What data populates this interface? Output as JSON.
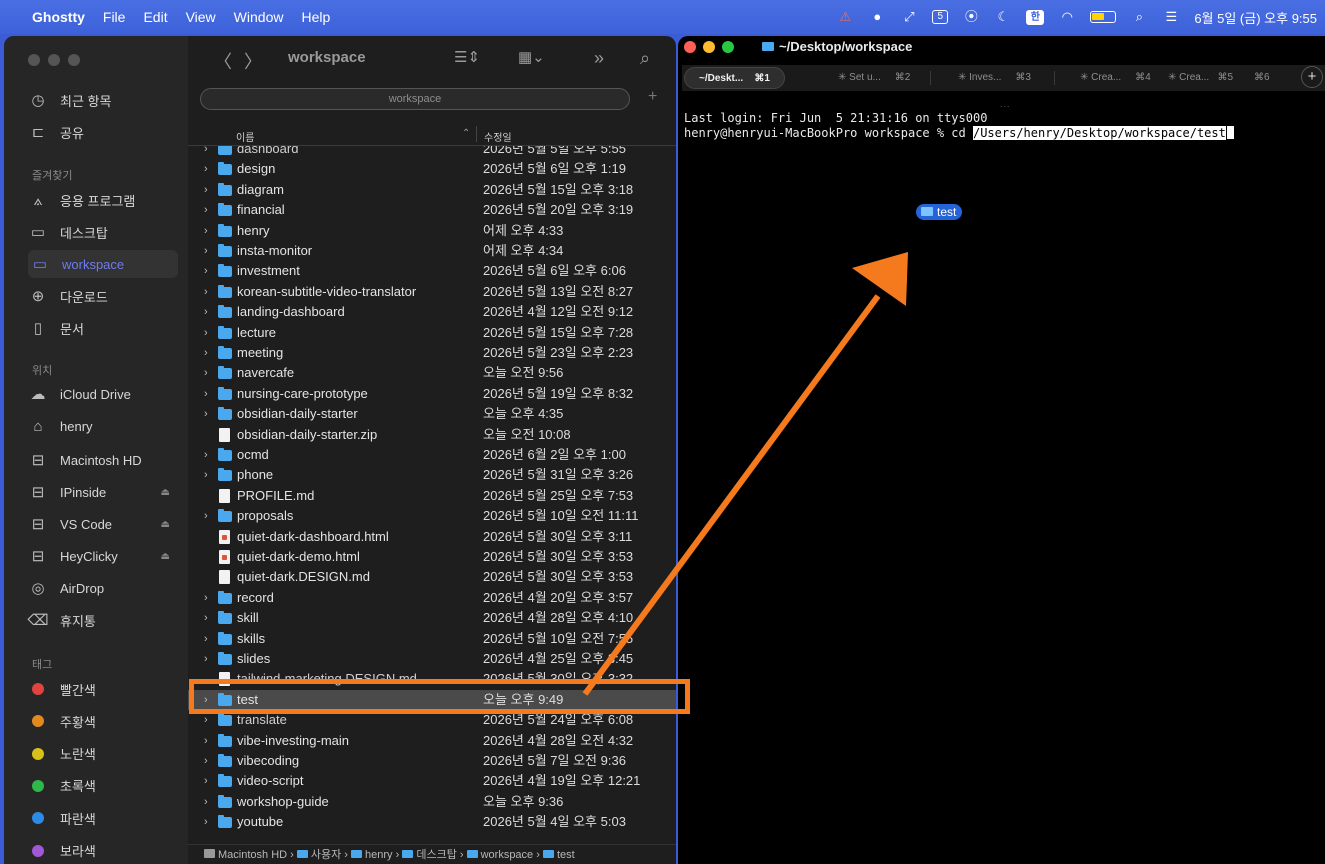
{
  "menubar": {
    "app": "Ghostty",
    "menus": [
      "File",
      "Edit",
      "View",
      "Window",
      "Help"
    ],
    "datetime": "6월 5일 (금) 오후 9:55",
    "calendar_badge": "5",
    "input_source": "한"
  },
  "finder": {
    "title": "workspace",
    "search_pill": "workspace",
    "sidebar": {
      "recents": "최근 항목",
      "shared": "공유",
      "favorites_header": "즐겨찾기",
      "favorites": [
        "응용 프로그램",
        "데스크탑",
        "workspace",
        "다운로드",
        "문서"
      ],
      "locations_header": "위치",
      "locations": [
        "iCloud Drive",
        "henry",
        "Macintosh HD",
        "IPinside",
        "VS Code",
        "HeyClicky",
        "AirDrop",
        "휴지통"
      ],
      "tags_header": "태그",
      "tags": [
        {
          "name": "빨간색",
          "color": "#e0443e"
        },
        {
          "name": "주황색",
          "color": "#e38a1e"
        },
        {
          "name": "노란색",
          "color": "#d8c21a"
        },
        {
          "name": "초록색",
          "color": "#2fb84a"
        },
        {
          "name": "파란색",
          "color": "#2d8ae6"
        },
        {
          "name": "보라색",
          "color": "#a158d6"
        }
      ]
    },
    "columns": {
      "name": "이름",
      "modified": "수정일"
    },
    "rows": [
      {
        "name": "dashboard",
        "date": "2026년 5월 5일 오후 5:55",
        "kind": "folder",
        "cut": true
      },
      {
        "name": "design",
        "date": "2026년 5월 6일 오후 1:19",
        "kind": "folder"
      },
      {
        "name": "diagram",
        "date": "2026년 5월 15일 오후 3:18",
        "kind": "folder"
      },
      {
        "name": "financial",
        "date": "2026년 5월 20일 오후 3:19",
        "kind": "folder"
      },
      {
        "name": "henry",
        "date": "어제 오후 4:33",
        "kind": "folder"
      },
      {
        "name": "insta-monitor",
        "date": "어제 오후 4:34",
        "kind": "folder"
      },
      {
        "name": "investment",
        "date": "2026년 5월 6일 오후 6:06",
        "kind": "folder"
      },
      {
        "name": "korean-subtitle-video-translator",
        "date": "2026년 5월 13일 오전 8:27",
        "kind": "folder"
      },
      {
        "name": "landing-dashboard",
        "date": "2026년 4월 12일 오전 9:12",
        "kind": "folder"
      },
      {
        "name": "lecture",
        "date": "2026년 5월 15일 오후 7:28",
        "kind": "folder"
      },
      {
        "name": "meeting",
        "date": "2026년 5월 23일 오후 2:23",
        "kind": "folder"
      },
      {
        "name": "navercafe",
        "date": "오늘 오전 9:56",
        "kind": "folder"
      },
      {
        "name": "nursing-care-prototype",
        "date": "2026년 5월 19일 오후 8:32",
        "kind": "folder"
      },
      {
        "name": "obsidian-daily-starter",
        "date": "오늘 오후 4:35",
        "kind": "folder"
      },
      {
        "name": "obsidian-daily-starter.zip",
        "date": "오늘 오전 10:08",
        "kind": "file"
      },
      {
        "name": "ocmd",
        "date": "2026년 6월 2일 오후 1:00",
        "kind": "folder"
      },
      {
        "name": "phone",
        "date": "2026년 5월 31일 오후 3:26",
        "kind": "folder"
      },
      {
        "name": "PROFILE.md",
        "date": "2026년 5월 25일 오후 7:53",
        "kind": "file"
      },
      {
        "name": "proposals",
        "date": "2026년 5월 10일 오전 11:11",
        "kind": "folder"
      },
      {
        "name": "quiet-dark-dashboard.html",
        "date": "2026년 5월 30일 오후 3:11",
        "kind": "html"
      },
      {
        "name": "quiet-dark-demo.html",
        "date": "2026년 5월 30일 오후 3:53",
        "kind": "html"
      },
      {
        "name": "quiet-dark.DESIGN.md",
        "date": "2026년 5월 30일 오후 3:53",
        "kind": "file"
      },
      {
        "name": "record",
        "date": "2026년 4월 20일 오후 3:57",
        "kind": "folder"
      },
      {
        "name": "skill",
        "date": "2026년 4월 28일 오후 4:10",
        "kind": "folder"
      },
      {
        "name": "skills",
        "date": "2026년 5월 10일 오전 7:55",
        "kind": "folder"
      },
      {
        "name": "slides",
        "date": "2026년 4월 25일 오후 3:45",
        "kind": "folder"
      },
      {
        "name": "tailwind-marketing.DESIGN.md",
        "date": "2026년 5월 30일 오후 3:32",
        "kind": "file",
        "cut": true
      },
      {
        "name": "test",
        "date": "오늘 오후 9:49",
        "kind": "folder",
        "selected": true
      },
      {
        "name": "translate",
        "date": "2026년 5월 24일 오후 6:08",
        "kind": "folder",
        "cut": true
      },
      {
        "name": "vibe-investing-main",
        "date": "2026년 4월 28일 오전 4:32",
        "kind": "folder"
      },
      {
        "name": "vibecoding",
        "date": "2026년 5월 7일 오전 9:36",
        "kind": "folder"
      },
      {
        "name": "video-script",
        "date": "2026년 4월 19일 오후 12:21",
        "kind": "folder"
      },
      {
        "name": "workshop-guide",
        "date": "오늘 오후 9:36",
        "kind": "folder"
      },
      {
        "name": "youtube",
        "date": "2026년 5월 4일 오후 5:03",
        "kind": "folder"
      }
    ],
    "pathbar": [
      "Macintosh HD",
      "사용자",
      "henry",
      "데스크탑",
      "workspace",
      "test"
    ]
  },
  "terminal": {
    "title": "~/Desktop/workspace",
    "tabs": [
      {
        "label": "~/Deskt...",
        "shortcut": "⌘1"
      },
      {
        "label": "✳ Set u...",
        "shortcut": "⌘2"
      },
      {
        "label": "✳ Inves...",
        "shortcut": "⌘3"
      },
      {
        "label": "✳ Crea...",
        "shortcut": "⌘4"
      },
      {
        "label": "✳ Crea...",
        "shortcut": "⌘5"
      },
      {
        "label": "",
        "shortcut": "⌘6"
      }
    ],
    "new_tab": "+",
    "dots": "...",
    "login_line": "Last login: Fri Jun  5 21:31:16 on ttys000",
    "prompt": "henry@henryui-MacBookPro workspace % cd ",
    "cmd_path": "/Users/henry/Desktop/workspace/test",
    "drag_chip": "test"
  },
  "colors": {
    "highlight": "#f57a1e",
    "menubar": "#3d61d9",
    "folder": "#4aa8ef"
  }
}
